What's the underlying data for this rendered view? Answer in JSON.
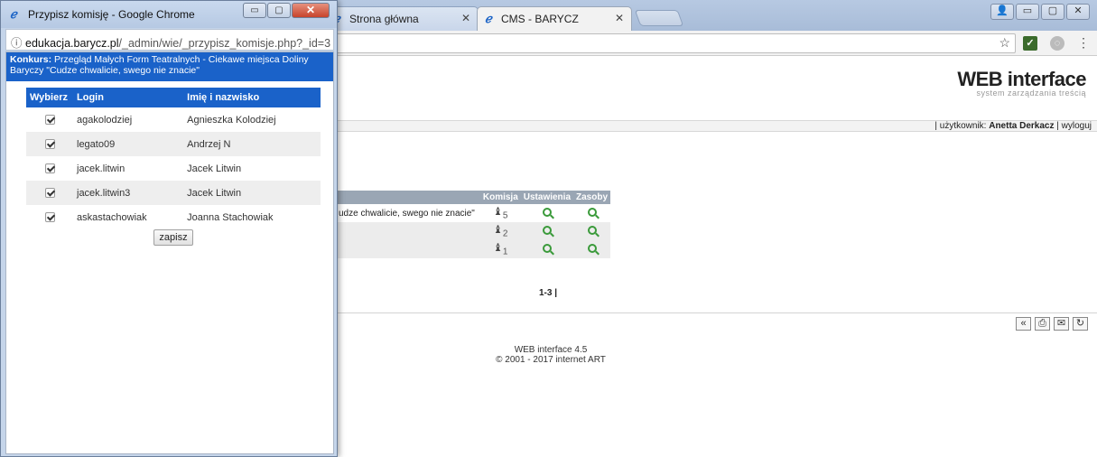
{
  "browser": {
    "tabs": [
      {
        "title": "Strona główna",
        "active": false
      },
      {
        "title": "CMS - BARYCZ",
        "active": true
      }
    ],
    "toolbar_icons": [
      "star-icon",
      "extension-icon",
      "extension-icon-2",
      "menu-icon"
    ]
  },
  "page": {
    "logo_main": "WEB interface",
    "logo_sub": "system zarządzania treścią",
    "user_label": "| użytkownik: ",
    "user_name": "Anetta Derkacz",
    "logout": " | wyloguj",
    "table": {
      "headers": [
        "Komisja",
        "Ustawienia",
        "Zasoby"
      ],
      "rows": [
        {
          "name": "udze chwalicie, swego nie znacie\"",
          "commission_count": "5"
        },
        {
          "name": "",
          "commission_count": "2"
        },
        {
          "name": "",
          "commission_count": "1"
        }
      ]
    },
    "pager": "1-3 |",
    "footer_line1": "WEB interface 4.5",
    "footer_line2": "© 2001 - 2017 internet ART"
  },
  "popup": {
    "title": "Przypisz komisję - Google Chrome",
    "url_host": "edukacja.barycz.pl",
    "url_path": "/_admin/wie/_przypisz_komisje.php?_id=3",
    "contest_label": "Konkurs:",
    "contest_name": " Przegląd Małych Form Teatralnych - Ciekawe miejsca Doliny Baryczy \"Cudze chwalicie, swego nie znacie\"",
    "headers": {
      "select": "Wybierz",
      "login": "Login",
      "name": "Imię i nazwisko"
    },
    "rows": [
      {
        "checked": true,
        "login": "agakolodziej",
        "name": "Agnieszka Kolodziej"
      },
      {
        "checked": true,
        "login": "legato09",
        "name": "Andrzej N"
      },
      {
        "checked": true,
        "login": "jacek.litwin",
        "name": "Jacek Litwin"
      },
      {
        "checked": true,
        "login": "jacek.litwin3",
        "name": "Jacek Litwin"
      },
      {
        "checked": true,
        "login": "askastachowiak",
        "name": "Joanna Stachowiak"
      }
    ],
    "save_label": "zapisz"
  }
}
